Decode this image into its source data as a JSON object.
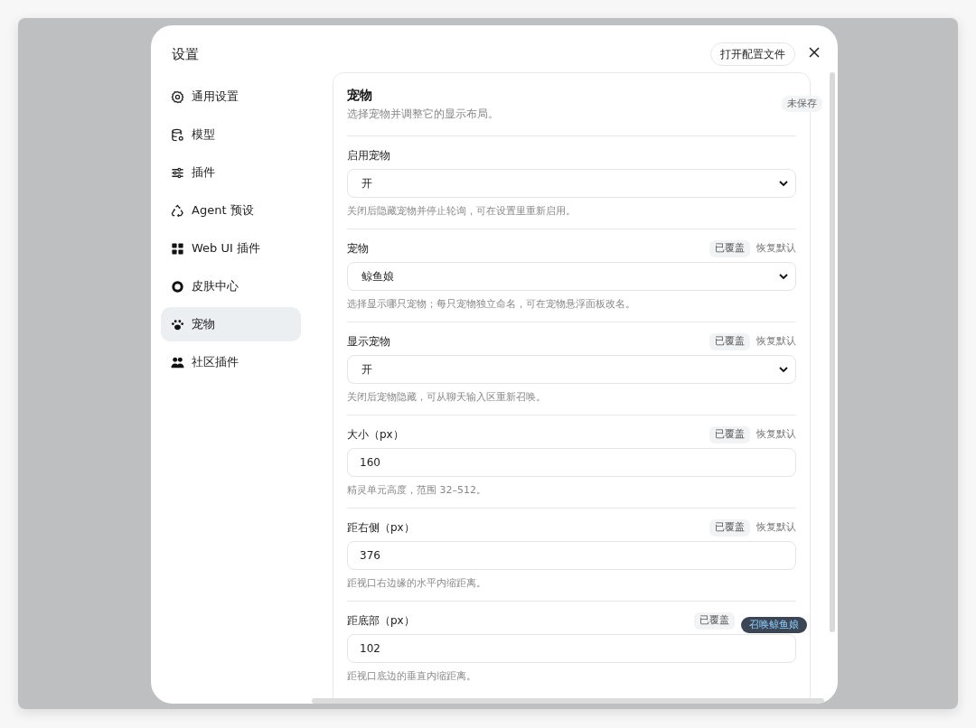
{
  "dialog": {
    "title": "设置",
    "open_config_button": "打开配置文件"
  },
  "sidebar": {
    "items": [
      {
        "label": "通用设置",
        "selected": false
      },
      {
        "label": "模型",
        "selected": false
      },
      {
        "label": "插件",
        "selected": false
      },
      {
        "label": "Agent 预设",
        "selected": false
      },
      {
        "label": "Web UI 插件",
        "selected": false
      },
      {
        "label": "皮肤中心",
        "selected": false
      },
      {
        "label": "宠物",
        "selected": true
      },
      {
        "label": "社区插件",
        "selected": false
      }
    ]
  },
  "panel": {
    "title": "宠物",
    "description": "选择宠物并调整它的显示布局。",
    "status_badge": "未保存"
  },
  "fields": [
    {
      "kind": "select",
      "label": "启用宠物",
      "value": "开",
      "help": "关闭后隐藏宠物并停止轮询，可在设置里重新启用。"
    },
    {
      "kind": "select",
      "label": "宠物",
      "badge": "已覆盖",
      "reset": "恢复默认",
      "value": "鲸鱼娘",
      "help": "选择显示哪只宠物；每只宠物独立命名，可在宠物悬浮面板改名。"
    },
    {
      "kind": "select",
      "label": "显示宠物",
      "badge": "已覆盖",
      "reset": "恢复默认",
      "value": "开",
      "help": "关闭后宠物隐藏，可从聊天输入区重新召唤。"
    },
    {
      "kind": "number",
      "label": "大小（px）",
      "badge": "已覆盖",
      "reset": "恢复默认",
      "value": "160",
      "help": "精灵单元高度，范围 32–512。"
    },
    {
      "kind": "number",
      "label": "距右侧（px）",
      "badge": "已覆盖",
      "reset": "恢复默认",
      "value": "376",
      "help": "距视口右边缘的水平内缩距离。"
    },
    {
      "kind": "number",
      "label": "距底部（px）",
      "badge": "已覆盖",
      "value": "102",
      "help": "距视口底边的垂直内缩距离。"
    }
  ],
  "floating_button": "召唤鲸鱼娘"
}
